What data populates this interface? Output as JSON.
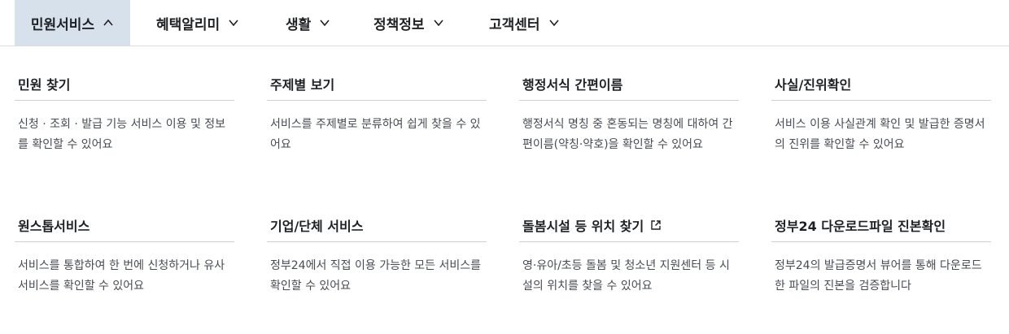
{
  "nav": {
    "items": [
      {
        "label": "민원서비스",
        "icon": "chevron-up-icon",
        "active": true
      },
      {
        "label": "혜택알리미",
        "icon": "chevron-down-icon",
        "active": false
      },
      {
        "label": "생활",
        "icon": "chevron-down-icon",
        "active": false
      },
      {
        "label": "정책정보",
        "icon": "chevron-down-icon",
        "active": false
      },
      {
        "label": "고객센터",
        "icon": "chevron-down-icon",
        "active": false
      }
    ],
    "active_bg": "#d7e1ec"
  },
  "cards": [
    {
      "title": "민원 찾기",
      "desc": "신청 · 조회 · 발급 기능 서비스 이용 및 정보를 확인할 수 있어요"
    },
    {
      "title": "주제별 보기",
      "desc": "서비스를 주제별로 분류하여 쉽게 찾을 수 있어요"
    },
    {
      "title": "행정서식 간편이름",
      "desc": "행정서식 명칭 중 혼동되는 명칭에 대하여 간편이름(약칭·약호)을 확인할 수 있어요"
    },
    {
      "title": "사실/진위확인",
      "desc": "서비스 이용 사실관계 확인 및 발급한 증명서의 진위를 확인할 수 있어요"
    },
    {
      "title": "원스톱서비스",
      "desc": "서비스를 통합하여 한 번에 신청하거나 유사 서비스를 확인할 수 있어요"
    },
    {
      "title": "기업/단체 서비스",
      "desc": "정부24에서 직접 이용 가능한 모든 서비스를 확인할 수 있어요"
    },
    {
      "title": "돌봄시설 등 위치 찾기",
      "desc": "영·유아/초등 돌봄 및 청소년 지원센터 등 시설의 위치를 찾을 수 있어요",
      "icon": "external-link-icon"
    },
    {
      "title": "정부24 다운로드파일 진본확인",
      "desc": "정부24의 발급증명서 뷰어를 통해 다운로드한 파일의 진본을 검증합니다"
    }
  ]
}
